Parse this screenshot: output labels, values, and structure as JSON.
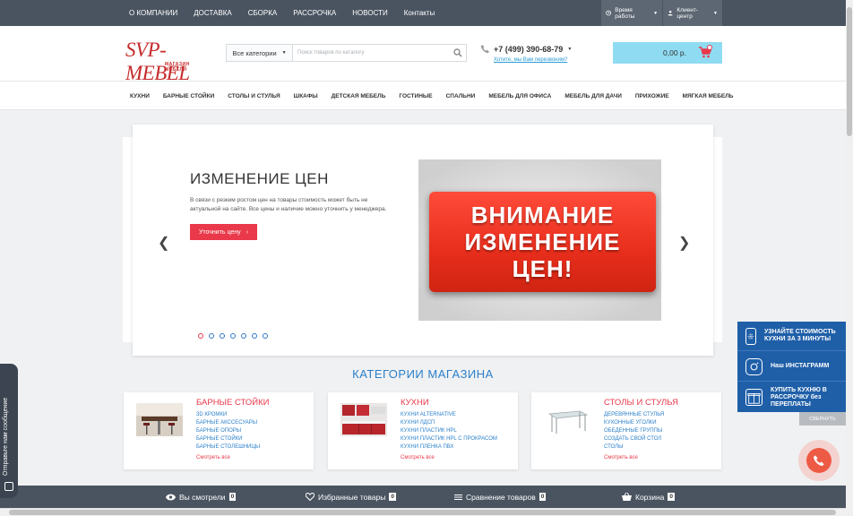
{
  "topnav": {
    "items": [
      "О КОМПАНИИ",
      "ДОСТАВКА",
      "СБОРКА",
      "РАССРОЧКА",
      "НОВОСТИ",
      "Контакты"
    ],
    "worktime": "Время работы",
    "client": "Клиент-центр"
  },
  "header": {
    "logo_main": "SVP-MEBEL",
    "logo_sub": "МАГАЗИН МЕБЕЛИ",
    "category_select": "Все категории",
    "search_placeholder": "Поиск товаров по каталогу",
    "phone": "+7 (499) 390-68-79",
    "callback": "Хотите, мы Вам перезвоним?",
    "cart_total": "0,00 р."
  },
  "mainnav": {
    "items": [
      "КУХНИ",
      "БАРНЫЕ СТОЙКИ",
      "СТОЛЫ И СТУЛЬЯ",
      "ШКАФЫ",
      "ДЕТСКАЯ МЕБЕЛЬ",
      "ГОСТИНЫЕ",
      "СПАЛЬНИ",
      "МЕБЕЛЬ ДЛЯ ОФИСА",
      "МЕБЕЛЬ ДЛЯ ДАЧИ",
      "ПРИХОЖИЕ",
      "МЯГКАЯ МЕБЕЛЬ"
    ]
  },
  "slider": {
    "title": "ИЗМЕНЕНИЕ ЦЕН",
    "text": "В связи с резким ростом цен на товары стоимость может быть не актуальной на сайте. Все цены и наличие можно уточнить у менеджера.",
    "button": "Уточнить цену",
    "image_lines": [
      "ВНИМАНИЕ",
      "ИЗМЕНЕНИЕ",
      "ЦЕН!"
    ],
    "arrow_prev": "❮",
    "arrow_next": "❯"
  },
  "categories": {
    "heading": "КАТЕГОРИИ МАГАЗИНА",
    "cards": [
      {
        "title": "БАРНЫЕ СТОЙКИ",
        "links": [
          "3D КРОМКИ",
          "БАРНЫЕ АКССЕСУАРЫ",
          "БАРНЫЕ ОПОРЫ",
          "БАРНЫЕ СТОЙКИ",
          "БАРНЫЕ СТОЛЕШНИЦЫ"
        ],
        "more": "Смотреть все"
      },
      {
        "title": "КУХНИ",
        "links": [
          "КУХНИ ALTERNATIVE",
          "КУХНИ ЛДСП",
          "КУХНИ ПЛАСТИК HPL",
          "КУХНИ ПЛАСТИК HPL С ПРОКРАСОМ",
          "КУХНИ ПЛЕНКА ПВХ"
        ],
        "more": "Смотреть все"
      },
      {
        "title": "СТОЛЫ И СТУЛЬЯ",
        "links": [
          "ДЕРЕВЯННЫЕ СТУЛЬЯ",
          "КУХОННЫЕ УГОЛКИ",
          "ОБЕДЕННЫЕ ГРУППЫ",
          "СОЗДАТЬ СВОЙ СТОЛ",
          "СТОЛЫ"
        ],
        "more": "Смотреть все"
      }
    ]
  },
  "bottombar": {
    "viewed": "Вы смотрели",
    "viewed_count": "0",
    "favorites": "Избранные товары",
    "favorites_count": "0",
    "compare": "Сравнение товаров",
    "compare_count": "0",
    "cart": "Корзина",
    "cart_count": "0"
  },
  "feedback": {
    "label": "Отправьте нам сообщение"
  },
  "sidepanel": {
    "items": [
      "УЗНАЙТЕ СТОИМОСТЬ КУХНИ ЗА 3 МИНУТЫ",
      "Наш ИНСТАГРАММ",
      "КУПИТЬ КУХНЮ В РАССРОЧКУ без ПЕРЕПЛАТЫ"
    ],
    "collapse": "свернуть"
  },
  "colors": {
    "accent": "#e9394a",
    "link": "#2a7fc9",
    "topbar": "#4a5461",
    "cart_bg": "#8fdcf2",
    "panel": "#1f5fa8"
  }
}
